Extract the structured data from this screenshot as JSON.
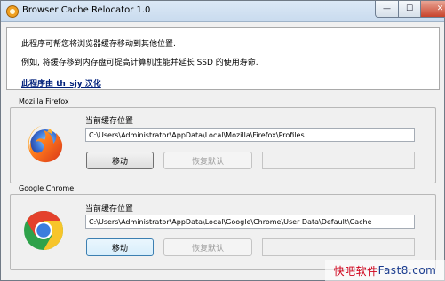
{
  "window": {
    "title": "Browser Cache Relocator 1.0",
    "caption_buttons": {
      "minimize": "—",
      "maximize": "☐",
      "close": "✕"
    }
  },
  "info": {
    "line1": "此程序可帮您将浏览器缓存移动到其他位置.",
    "line2": "例如, 将缓存移到内存盘可提高计算机性能并延长 SSD 的使用寿命.",
    "link": "此程序由 th_sjy 汉化"
  },
  "firefox": {
    "group_label": "Mozilla Firefox",
    "cache_label": "当前缓存位置",
    "path": "C:\\Users\\Administrator\\AppData\\Local\\Mozilla\\Firefox\\Profiles",
    "move_label": "移动",
    "restore_label": "恢复默认",
    "status": ""
  },
  "chrome": {
    "group_label": "Google Chrome",
    "cache_label": "当前缓存位置",
    "path": "C:\\Users\\Administrator\\AppData\\Local\\Google\\Chrome\\User Data\\Default\\Cache",
    "move_label": "移动",
    "restore_label": "恢复默认",
    "status": ""
  },
  "watermark": {
    "part1": "快吧软件",
    "part2": "Fast8.com"
  },
  "icons": {
    "app": "browser-cache-relocator-icon",
    "firefox": "firefox-logo-icon",
    "chrome": "chrome-logo-icon"
  },
  "colors": {
    "link": "#00207a",
    "close_button": "#c8432b",
    "watermark_red": "#d0021b",
    "watermark_blue": "#1a3c8f"
  }
}
